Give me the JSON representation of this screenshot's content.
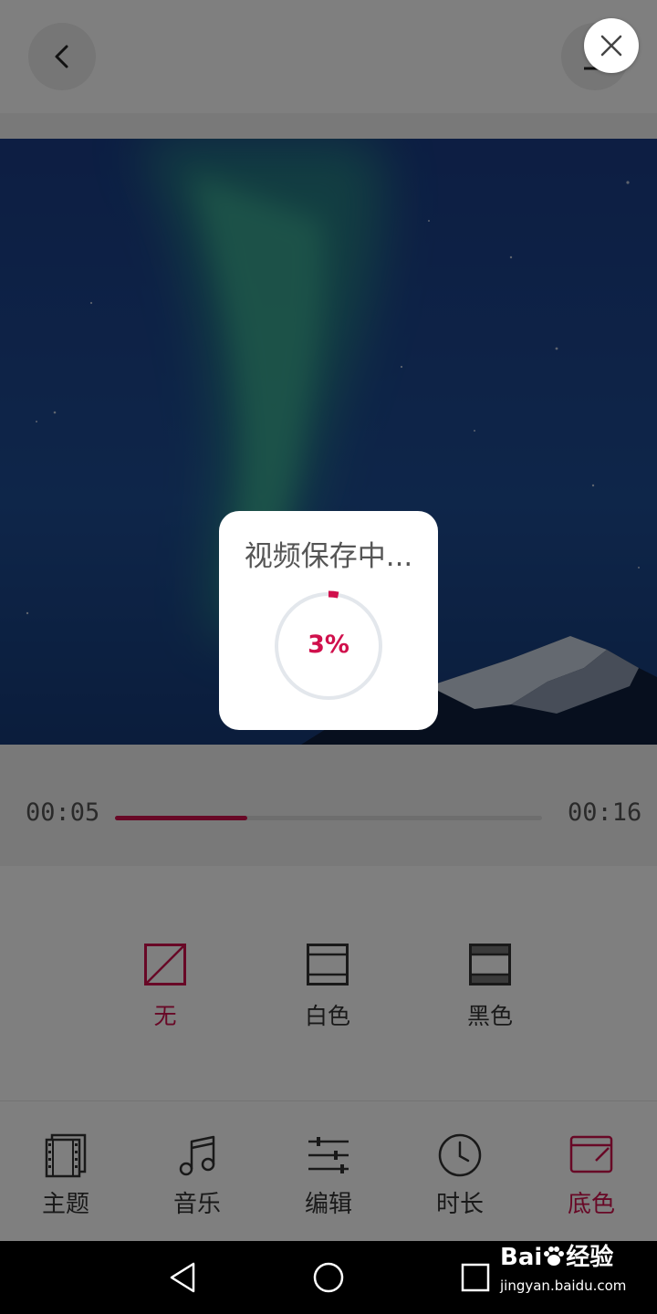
{
  "dialog": {
    "title": "视频保存中...",
    "percent_label": "3%",
    "progress": 0.03
  },
  "player": {
    "current_time": "00:05",
    "total_time": "00:16",
    "progress": 0.31
  },
  "background_options": [
    {
      "label": "无",
      "icon": "none-frame-icon",
      "selected": true
    },
    {
      "label": "白色",
      "icon": "white-frame-icon",
      "selected": false
    },
    {
      "label": "黑色",
      "icon": "black-frame-icon",
      "selected": false
    }
  ],
  "tabs": [
    {
      "label": "主题",
      "icon": "film-icon",
      "active": false
    },
    {
      "label": "音乐",
      "icon": "music-note-icon",
      "active": false
    },
    {
      "label": "编辑",
      "icon": "sliders-icon",
      "active": false
    },
    {
      "label": "时长",
      "icon": "clock-icon",
      "active": false
    },
    {
      "label": "底色",
      "icon": "background-color-icon",
      "active": true
    }
  ],
  "watermark": {
    "brand": "Bai",
    "brand_cn": "经验",
    "url": "jingyan.baidu.com"
  },
  "colors": {
    "accent": "#d0104c",
    "text": "#333333",
    "overlay": "rgba(0,0,0,0.5)"
  }
}
